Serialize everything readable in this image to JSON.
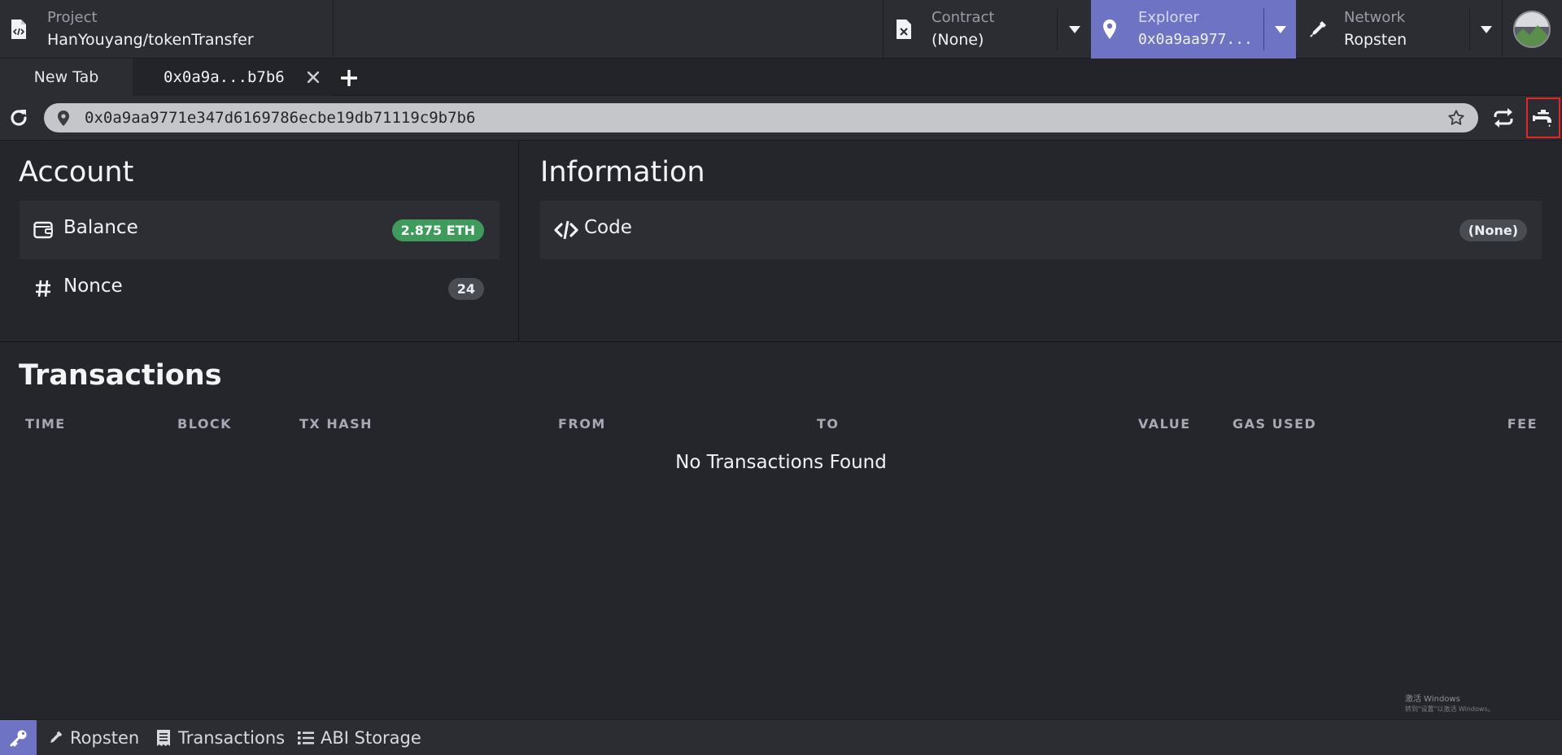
{
  "header": {
    "project": {
      "label": "Project",
      "value": "HanYouyang/tokenTransfer",
      "icon": "file-code-icon"
    },
    "contract": {
      "label": "Contract",
      "value": "(None)",
      "icon": "file-x-icon"
    },
    "explorer": {
      "label": "Explorer",
      "value": "0x0a9aa977...",
      "icon": "map-pin-icon"
    },
    "network": {
      "label": "Network",
      "value": "Ropsten",
      "icon": "eyedropper-icon"
    },
    "colors": {
      "accent": "#6f73c4",
      "background": "#2c2d33"
    }
  },
  "tabs": {
    "new_tab_label": "New Tab",
    "active_tab_label": "0x0a9a...b7b6",
    "close_glyph": "✕",
    "add_glyph": "+"
  },
  "address_bar": {
    "value": "0x0a9aa9771e347d6169786ecbe19db71119c9b7b6"
  },
  "account": {
    "title": "Account",
    "balance_label": "Balance",
    "balance_value": "2.875 ETH",
    "nonce_label": "Nonce",
    "nonce_value": "24"
  },
  "information": {
    "title": "Information",
    "code_label": "Code",
    "code_value": "(None)"
  },
  "transactions": {
    "title": "Transactions",
    "columns": [
      "TIME",
      "BLOCK",
      "TX HASH",
      "FROM",
      "TO",
      "VALUE",
      "GAS USED",
      "FEE"
    ],
    "empty_message": "No Transactions Found"
  },
  "watermark": {
    "line1": "激活 Windows",
    "line2": "转到\"设置\"以激活 Windows。"
  },
  "statusbar": {
    "network": "Ropsten",
    "transactions": "Transactions",
    "abi_storage": "ABI Storage"
  }
}
